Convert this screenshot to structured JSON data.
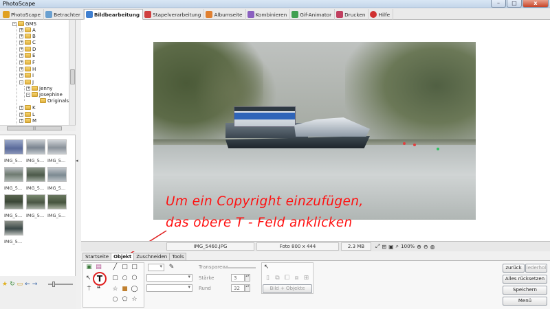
{
  "window": {
    "title": "PhotoScape",
    "minimize": "–",
    "maximize": "□",
    "close": "x"
  },
  "tabs": [
    {
      "label": "PhotoScape",
      "color": "#e0a020"
    },
    {
      "label": "Betrachter",
      "color": "#6aa0d0"
    },
    {
      "label": "Bildbearbeitung",
      "color": "#3f7fd0"
    },
    {
      "label": "Stapelverarbeitung",
      "color": "#d04040"
    },
    {
      "label": "Albumseite",
      "color": "#e08030"
    },
    {
      "label": "Kombinieren",
      "color": "#8a60c0"
    },
    {
      "label": "Gif-Animator",
      "color": "#40a050"
    },
    {
      "label": "Drucken",
      "color": "#c04060"
    },
    {
      "label": "Hilfe",
      "color": "#d03030"
    }
  ],
  "tree": {
    "root": "GMS",
    "letters": [
      "A",
      "B",
      "C",
      "D",
      "E",
      "F",
      "H",
      "I",
      "J"
    ],
    "sub": [
      "Jenny",
      "Josephine"
    ],
    "subsub": "Originals",
    "after": [
      "K",
      "L",
      "M"
    ],
    "scroll_grip": "|||",
    "expand": "+",
    "collapse": "–"
  },
  "thumbnails": {
    "caption": "IMG_5...",
    "count": 10
  },
  "splitter_arrow": "◂",
  "annotation": {
    "line1": "Um ein Copyright einzufügen,",
    "line2": "das obere T - Feld anklicken"
  },
  "infobar": {
    "filename": "IMG_5460.JPG",
    "dims": "Foto 800 x 444",
    "size": "2.3 MB",
    "zoom": "100%"
  },
  "editor_tabs": [
    "Startseite",
    "Objekt",
    "Zuschneiden",
    "Tools"
  ],
  "object_panel": {
    "transparency_label": "Transparenz",
    "strength_label": "Stärke",
    "strength_value": "3",
    "round_label": "Rund",
    "round_value": "32",
    "text_tool": "T",
    "quote_tool": "❝",
    "bild_objekte": "Bild + Objekte"
  },
  "right_buttons": {
    "back": "zurück",
    "forward": "lederhol",
    "reset_all": "Alles rücksetzen",
    "save": "Speichern",
    "menu": "Menü"
  }
}
